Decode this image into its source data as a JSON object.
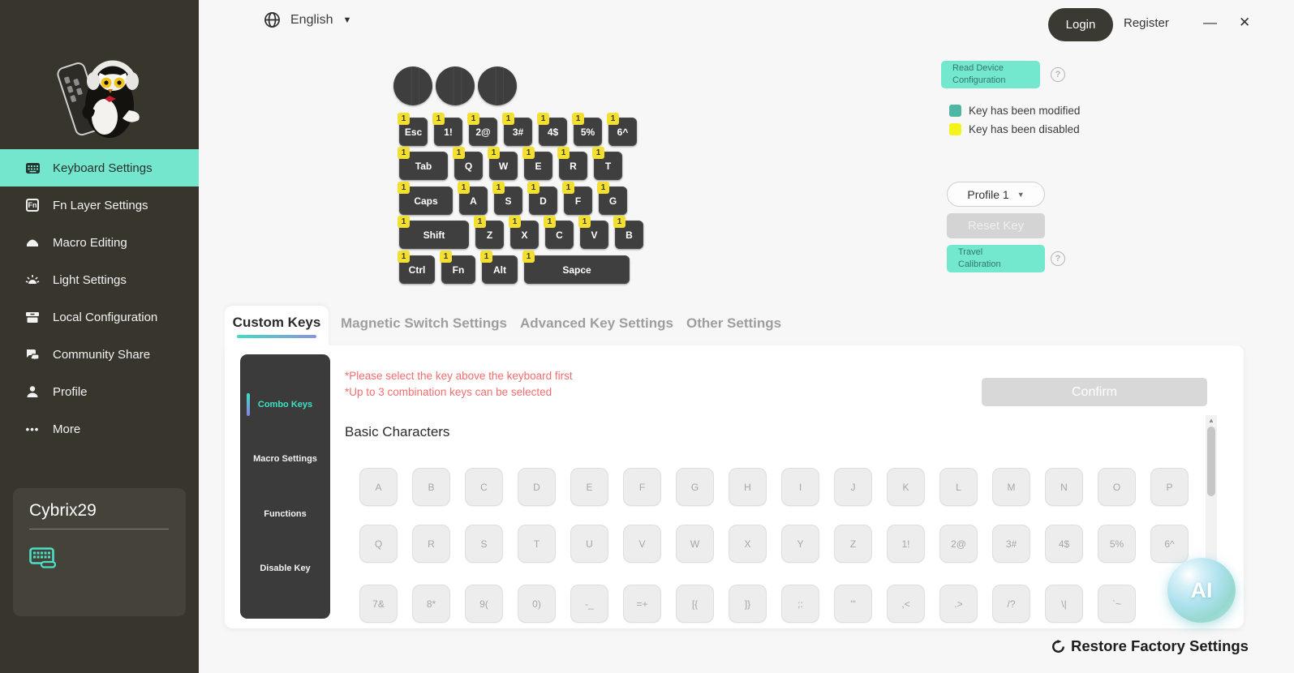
{
  "topbar": {
    "language": "English",
    "login_label": "Login",
    "register_label": "Register",
    "minimize_glyph": "—",
    "close_glyph": "✕"
  },
  "sidebar": {
    "items": [
      {
        "label": "Keyboard Settings",
        "icon": "keyboard-icon",
        "active": true
      },
      {
        "label": "Fn Layer Settings",
        "icon": "fn-icon",
        "active": false
      },
      {
        "label": "Macro Editing",
        "icon": "macro-icon",
        "active": false
      },
      {
        "label": "Light Settings",
        "icon": "light-icon",
        "active": false
      },
      {
        "label": "Local Configuration",
        "icon": "archive-box-icon",
        "active": false
      },
      {
        "label": "Community Share",
        "icon": "chat-bubbles-icon",
        "active": false
      },
      {
        "label": "Profile",
        "icon": "person-icon",
        "active": false
      },
      {
        "label": "More",
        "icon": "ellipsis-icon",
        "active": false
      }
    ],
    "user_card": {
      "username": "Cybrix29"
    }
  },
  "device": {
    "knobs": 3,
    "key_badge": "1",
    "rows": [
      [
        "Esc",
        "1!",
        "2@",
        "3#",
        "4$",
        "5%",
        "6^"
      ],
      [
        "Tab",
        "Q",
        "W",
        "E",
        "R",
        "T"
      ],
      [
        "Caps",
        "A",
        "S",
        "D",
        "F",
        "G"
      ],
      [
        "Shift",
        "Z",
        "X",
        "C",
        "V",
        "B"
      ],
      [
        "Ctrl",
        "Fn",
        "Alt",
        "Sapce"
      ]
    ]
  },
  "right_panel": {
    "read_device_line1": "Read Device",
    "read_device_line2": "Configuration",
    "legend": [
      {
        "label": "Key has been modified",
        "color": "#4eb7a3"
      },
      {
        "label": "Key has been disabled",
        "color": "#f4f41d"
      }
    ],
    "profile_selected": "Profile 1",
    "reset_key_label": "Reset Key",
    "travel_line1": "Travel",
    "travel_line2": "Calibration"
  },
  "tabs": [
    {
      "label": "Custom Keys",
      "active": true
    },
    {
      "label": "Magnetic Switch Settings",
      "active": false
    },
    {
      "label": "Advanced Key Settings",
      "active": false
    },
    {
      "label": "Other Settings",
      "active": false
    }
  ],
  "custom_keys": {
    "subnav": [
      {
        "label": "Combo Keys",
        "active": true
      },
      {
        "label": "Macro Settings",
        "active": false
      },
      {
        "label": "Functions",
        "active": false
      },
      {
        "label": "Disable Key",
        "active": false
      }
    ],
    "warnings": [
      "*Please select the key above the keyboard first",
      "*Up to 3 combination keys can be selected"
    ],
    "confirm_label": "Confirm",
    "section_title": "Basic Characters",
    "key_grid": [
      [
        "A",
        "B",
        "C",
        "D",
        "E",
        "F",
        "G",
        "H",
        "I",
        "J",
        "K",
        "L",
        "M",
        "N",
        "O",
        "P"
      ],
      [
        "Q",
        "R",
        "S",
        "T",
        "U",
        "V",
        "W",
        "X",
        "Y",
        "Z",
        "1!",
        "2@",
        "3#",
        "4$",
        "5%",
        "6^"
      ],
      [
        "7&",
        "8*",
        "9(",
        "0)",
        "-_",
        "=+",
        "[{",
        "]}",
        ";:",
        "'\"",
        ",<",
        ".>",
        "/?",
        "\\|",
        "`~"
      ]
    ]
  },
  "footer": {
    "restore_label": "Restore Factory Settings"
  },
  "ai_bubble": {
    "label": "AI"
  },
  "icons": {
    "question": "?",
    "caret_down": "▼",
    "caret_small": "▼",
    "ellipsis": "•••",
    "fn": "Fn",
    "scroll_up": "▲"
  },
  "colors": {
    "sidebar_bg": "#38352d",
    "accent_mint": "#75e6ce",
    "badge_yellow": "#f2df2f",
    "warning_red": "#f56c6c",
    "subnav_active": "#40e0c4",
    "key_dark": "#3f3f3f"
  }
}
